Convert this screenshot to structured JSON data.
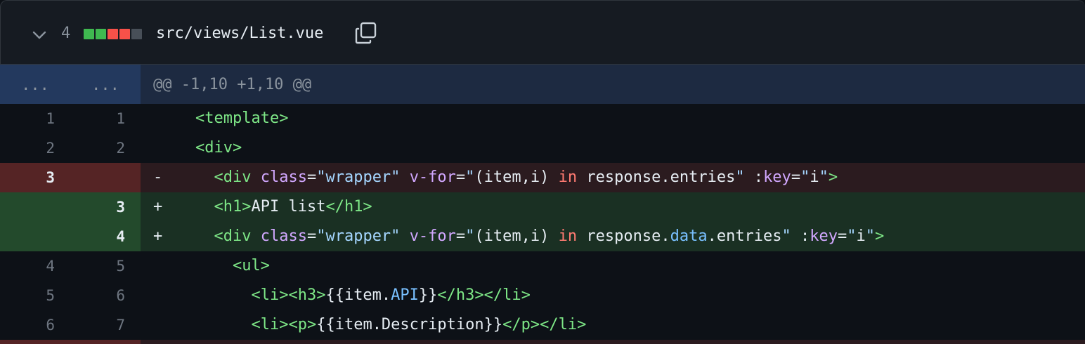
{
  "file": {
    "changes": "4",
    "path": "src/views/List.vue",
    "diffstat_colors": [
      "#3fb950",
      "#3fb950",
      "#f85149",
      "#f85149",
      "#484f58"
    ]
  },
  "hunk": {
    "left": "...",
    "right": "...",
    "header": "@@ -1,10 +1,10 @@"
  },
  "lines": [
    {
      "type": "ctx",
      "old": "1",
      "new": "1",
      "marker": " ",
      "indent": "",
      "tokens": [
        {
          "c": "tag",
          "t": "<template>"
        }
      ]
    },
    {
      "type": "ctx",
      "old": "2",
      "new": "2",
      "marker": " ",
      "indent": "",
      "tokens": [
        {
          "c": "tag",
          "t": "<div>"
        }
      ]
    },
    {
      "type": "del",
      "old": "3",
      "new": "",
      "marker": "-",
      "indent": "  ",
      "tokens": [
        {
          "c": "tag",
          "t": "<div"
        },
        {
          "c": "plain",
          "t": " "
        },
        {
          "c": "attr",
          "t": "class"
        },
        {
          "c": "plain",
          "t": "="
        },
        {
          "c": "str",
          "t": "\"wrapper\""
        },
        {
          "c": "plain",
          "t": " "
        },
        {
          "c": "attr",
          "t": "v-for"
        },
        {
          "c": "plain",
          "t": "="
        },
        {
          "c": "str",
          "t": "\""
        },
        {
          "c": "plain",
          "t": "(item,i) "
        },
        {
          "c": "kw",
          "t": "in"
        },
        {
          "c": "plain",
          "t": " response.entries"
        },
        {
          "c": "str",
          "t": "\""
        },
        {
          "c": "plain",
          "t": " :"
        },
        {
          "c": "attr",
          "t": "key"
        },
        {
          "c": "plain",
          "t": "="
        },
        {
          "c": "str",
          "t": "\""
        },
        {
          "c": "plain",
          "t": "i"
        },
        {
          "c": "str",
          "t": "\""
        },
        {
          "c": "tag",
          "t": ">"
        }
      ]
    },
    {
      "type": "add",
      "old": "",
      "new": "3",
      "marker": "+",
      "indent": "  ",
      "tokens": [
        {
          "c": "tag",
          "t": "<h1>"
        },
        {
          "c": "plain",
          "t": "API list"
        },
        {
          "c": "tag",
          "t": "</h1>"
        }
      ]
    },
    {
      "type": "add",
      "old": "",
      "new": "4",
      "marker": "+",
      "indent": "  ",
      "tokens": [
        {
          "c": "tag",
          "t": "<div"
        },
        {
          "c": "plain",
          "t": " "
        },
        {
          "c": "attr",
          "t": "class"
        },
        {
          "c": "plain",
          "t": "="
        },
        {
          "c": "str",
          "t": "\"wrapper\""
        },
        {
          "c": "plain",
          "t": " "
        },
        {
          "c": "attr",
          "t": "v-for"
        },
        {
          "c": "plain",
          "t": "="
        },
        {
          "c": "str",
          "t": "\""
        },
        {
          "c": "plain",
          "t": "(item,i) "
        },
        {
          "c": "kw",
          "t": "in"
        },
        {
          "c": "plain",
          "t": " response."
        },
        {
          "c": "prop",
          "t": "data"
        },
        {
          "c": "plain",
          "t": ".entries"
        },
        {
          "c": "str",
          "t": "\""
        },
        {
          "c": "plain",
          "t": " :"
        },
        {
          "c": "attr",
          "t": "key"
        },
        {
          "c": "plain",
          "t": "="
        },
        {
          "c": "str",
          "t": "\""
        },
        {
          "c": "plain",
          "t": "i"
        },
        {
          "c": "str",
          "t": "\""
        },
        {
          "c": "tag",
          "t": ">"
        }
      ]
    },
    {
      "type": "ctx",
      "old": "4",
      "new": "5",
      "marker": " ",
      "indent": "    ",
      "tokens": [
        {
          "c": "tag",
          "t": "<ul>"
        }
      ]
    },
    {
      "type": "ctx",
      "old": "5",
      "new": "6",
      "marker": " ",
      "indent": "      ",
      "tokens": [
        {
          "c": "tag",
          "t": "<li>"
        },
        {
          "c": "tag",
          "t": "<h3>"
        },
        {
          "c": "plain",
          "t": "{{item."
        },
        {
          "c": "prop",
          "t": "API"
        },
        {
          "c": "plain",
          "t": "}}"
        },
        {
          "c": "tag",
          "t": "</h3>"
        },
        {
          "c": "tag",
          "t": "</li>"
        }
      ]
    },
    {
      "type": "ctx",
      "old": "6",
      "new": "7",
      "marker": " ",
      "indent": "      ",
      "tokens": [
        {
          "c": "tag",
          "t": "<li>"
        },
        {
          "c": "tag",
          "t": "<p>"
        },
        {
          "c": "plain",
          "t": "{{item.Description}}"
        },
        {
          "c": "tag",
          "t": "</p>"
        },
        {
          "c": "tag",
          "t": "</li>"
        }
      ]
    }
  ]
}
